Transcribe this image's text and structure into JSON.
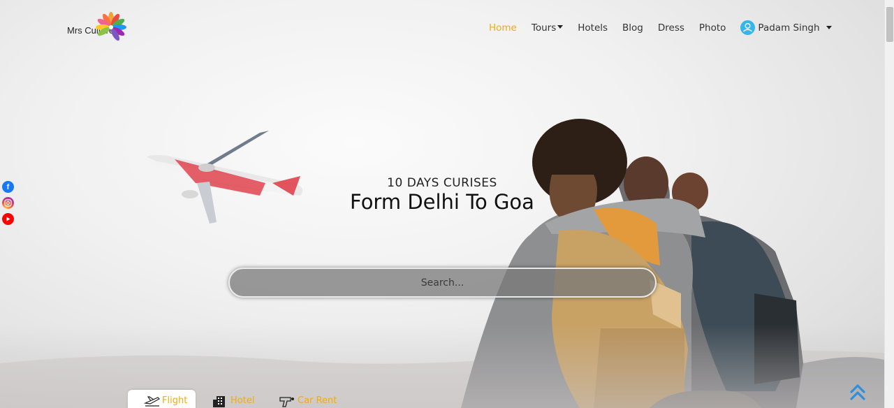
{
  "logo": {
    "text": "Mrs Culture"
  },
  "nav": {
    "items": [
      {
        "label": "Home",
        "active": true
      },
      {
        "label": "Tours",
        "dropdown": true
      },
      {
        "label": "Hotels"
      },
      {
        "label": "Blog"
      },
      {
        "label": "Dress"
      },
      {
        "label": "Photo"
      }
    ],
    "user": {
      "name": "Padam Singh"
    }
  },
  "social": {
    "icons": [
      "facebook-icon",
      "instagram-icon",
      "youtube-icon"
    ]
  },
  "hero": {
    "subtitle": "10 DAYS CURISES",
    "title": "Form Delhi To Goa",
    "search_placeholder": "Search..."
  },
  "tabs": [
    {
      "label": "Flight",
      "icon": "flight-icon",
      "active": true
    },
    {
      "label": "Hotel",
      "icon": "hotel-icon"
    },
    {
      "label": "Car Rent",
      "icon": "car-rent-icon"
    }
  ],
  "colors": {
    "accent": "#f0ac11",
    "avatar": "#35b6ea",
    "scroll_top": "#2f8fd8"
  }
}
